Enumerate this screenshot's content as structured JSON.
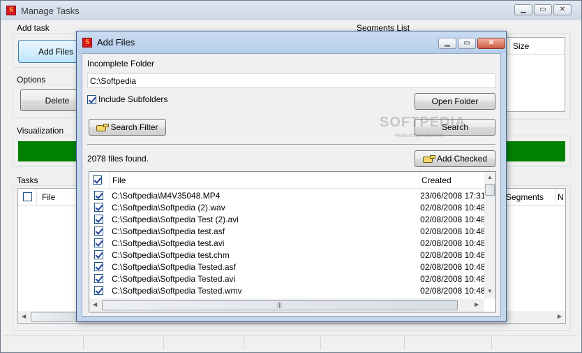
{
  "main": {
    "title": "Manage Tasks",
    "add_task_label": "Add task",
    "add_files_button": "Add Files",
    "segments_list_label": "Segments List",
    "segments_size_header": "Size",
    "options_label": "Options",
    "delete_button": "Delete",
    "visualization_label": "Visualization",
    "visualization_color": "#008000",
    "tasks_label": "Tasks",
    "tasks_columns": [
      "File",
      "Segments",
      "N"
    ]
  },
  "dialog": {
    "title": "Add Files",
    "incomplete_folder_label": "Incomplete Folder",
    "folder_value": "C:\\Softpedia",
    "include_subfolders_label": "Include Subfolders",
    "include_subfolders_checked": true,
    "open_folder_button": "Open Folder",
    "search_filter_button": "Search Filter",
    "search_button": "Search",
    "files_found": "2078 files found.",
    "add_checked_button": "Add Checked",
    "columns": {
      "file": "File",
      "created": "Created"
    },
    "rows": [
      {
        "file": "C:\\Softpedia\\M4V35048.MP4",
        "created": "23/06/2008 17:31"
      },
      {
        "file": "C:\\Softpedia\\Softpedia (2).wav",
        "created": "02/08/2008 10:48"
      },
      {
        "file": "C:\\Softpedia\\Softpedia Test (2).avi",
        "created": "02/08/2008 10:48"
      },
      {
        "file": "C:\\Softpedia\\Softpedia test.asf",
        "created": "02/08/2008 10:48"
      },
      {
        "file": "C:\\Softpedia\\Softpedia test.avi",
        "created": "02/08/2008 10:48"
      },
      {
        "file": "C:\\Softpedia\\Softpedia test.chm",
        "created": "02/08/2008 10:48"
      },
      {
        "file": "C:\\Softpedia\\Softpedia Tested.asf",
        "created": "02/08/2008 10:48"
      },
      {
        "file": "C:\\Softpedia\\Softpedia Tested.avi",
        "created": "02/08/2008 10:48"
      },
      {
        "file": "C:\\Softpedia\\Softpedia Tested.wmv",
        "created": "02/08/2008 10:48"
      }
    ],
    "watermark": "SOFTPEDIA",
    "watermark_sub": "www.softpedia.com"
  },
  "icons": {
    "app": "S"
  }
}
